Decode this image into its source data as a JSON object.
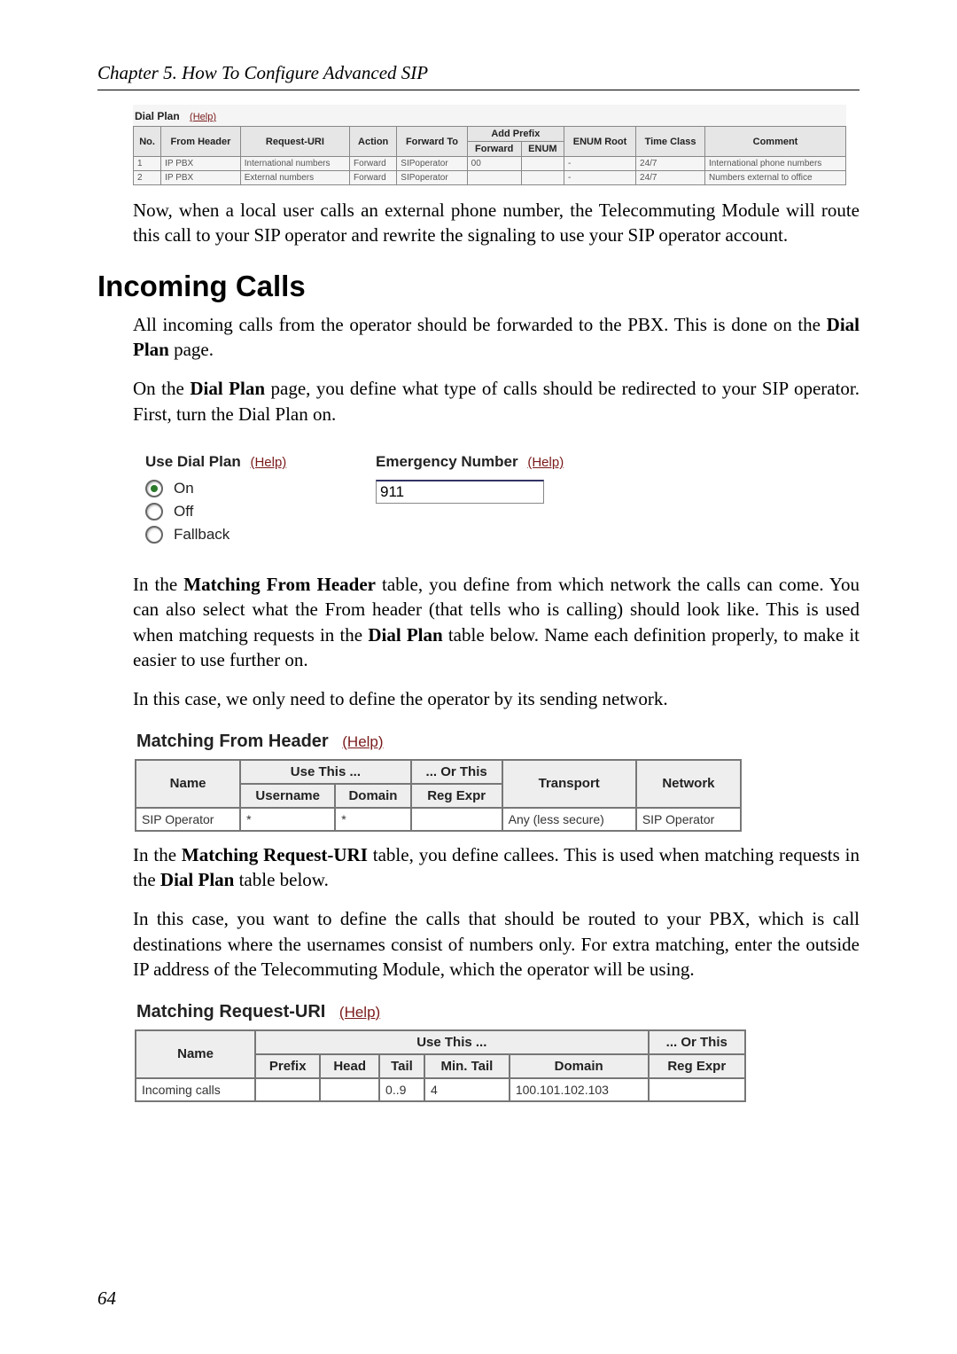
{
  "chapter": "Chapter 5. How To Configure Advanced SIP",
  "dial_plan": {
    "title": "Dial Plan",
    "help": "(Help)",
    "headers": {
      "no": "No.",
      "from_header": "From Header",
      "request_uri": "Request-URI",
      "action": "Action",
      "forward_to": "Forward To",
      "add_prefix": "Add Prefix",
      "add_prefix_forward": "Forward",
      "add_prefix_enum": "ENUM",
      "enum_root": "ENUM Root",
      "time_class": "Time Class",
      "comment": "Comment"
    },
    "rows": [
      {
        "no": "1",
        "from": "IP PBX",
        "uri": "International numbers",
        "action": "Forward",
        "fwd": "SIPoperator",
        "apf": "00",
        "ape": "",
        "root": "-",
        "tc": "24/7",
        "comment": "International phone numbers"
      },
      {
        "no": "2",
        "from": "IP PBX",
        "uri": "External numbers",
        "action": "Forward",
        "fwd": "SIPoperator",
        "apf": "",
        "ape": "",
        "root": "-",
        "tc": "24/7",
        "comment": "Numbers external to office"
      }
    ]
  },
  "para1": "Now, when a local user calls an external phone number, the Telecommuting Module will route this call to your SIP operator and rewrite the signaling to use your SIP operator account.",
  "h2": "Incoming Calls",
  "para2a": "All incoming calls from the operator should be forwarded to the PBX. This is done on the ",
  "para2b": "Dial Plan",
  "para2c": " page.",
  "para3a": "On the ",
  "para3b": "Dial Plan",
  "para3c": " page, you define what type of calls should be redirected to your SIP operator. First, turn the Dial Plan on.",
  "use_dial_plan": {
    "title": "Use Dial Plan",
    "help": "(Help)",
    "options": [
      "On",
      "Off",
      "Fallback"
    ],
    "selected": "On",
    "emergency_title": "Emergency Number",
    "emergency_help": "(Help)",
    "emergency_value": "911"
  },
  "para4a": "In the ",
  "para4b": "Matching From Header",
  "para4c": " table, you define from which network the calls can come. You can also select what the From header (that tells who is calling) should look like. This is used when matching requests in the ",
  "para4d": "Dial Plan",
  "para4e": " table below. Name each definition properly, to make it easier to use further on.",
  "para5": "In this case, we only need to define the operator by its sending network.",
  "mfh": {
    "title": "Matching From Header",
    "help": "(Help)",
    "headers": {
      "name": "Name",
      "use_this": "Use This ...",
      "or_this": "... Or This",
      "username": "Username",
      "domain": "Domain",
      "reg_expr": "Reg Expr",
      "transport": "Transport",
      "network": "Network"
    },
    "row": {
      "name": "SIP Operator",
      "username": "*",
      "domain": "*",
      "reg_expr": "",
      "transport": "Any (less secure)",
      "network": "SIP Operator"
    }
  },
  "para6a": "In the ",
  "para6b": "Matching Request-URI",
  "para6c": " table, you define callees. This is used when matching requests in the ",
  "para6d": "Dial Plan",
  "para6e": " table below.",
  "para7": "In this case, you want to define the calls that should be routed to your PBX, which is call destinations where the usernames consist of numbers only. For extra matching, enter the outside IP address of the Telecommuting Module, which the operator will be using.",
  "mru": {
    "title": "Matching Request-URI",
    "help": "(Help)",
    "headers": {
      "name": "Name",
      "use_this": "Use This ...",
      "or_this": "... Or This",
      "prefix": "Prefix",
      "head": "Head",
      "tail": "Tail",
      "min_tail": "Min. Tail",
      "domain": "Domain",
      "reg_expr": "Reg Expr"
    },
    "row": {
      "name": "Incoming calls",
      "prefix": "",
      "head": "",
      "tail": "0..9",
      "min_tail": "4",
      "domain": "100.101.102.103",
      "reg_expr": ""
    }
  },
  "page_number": "64"
}
